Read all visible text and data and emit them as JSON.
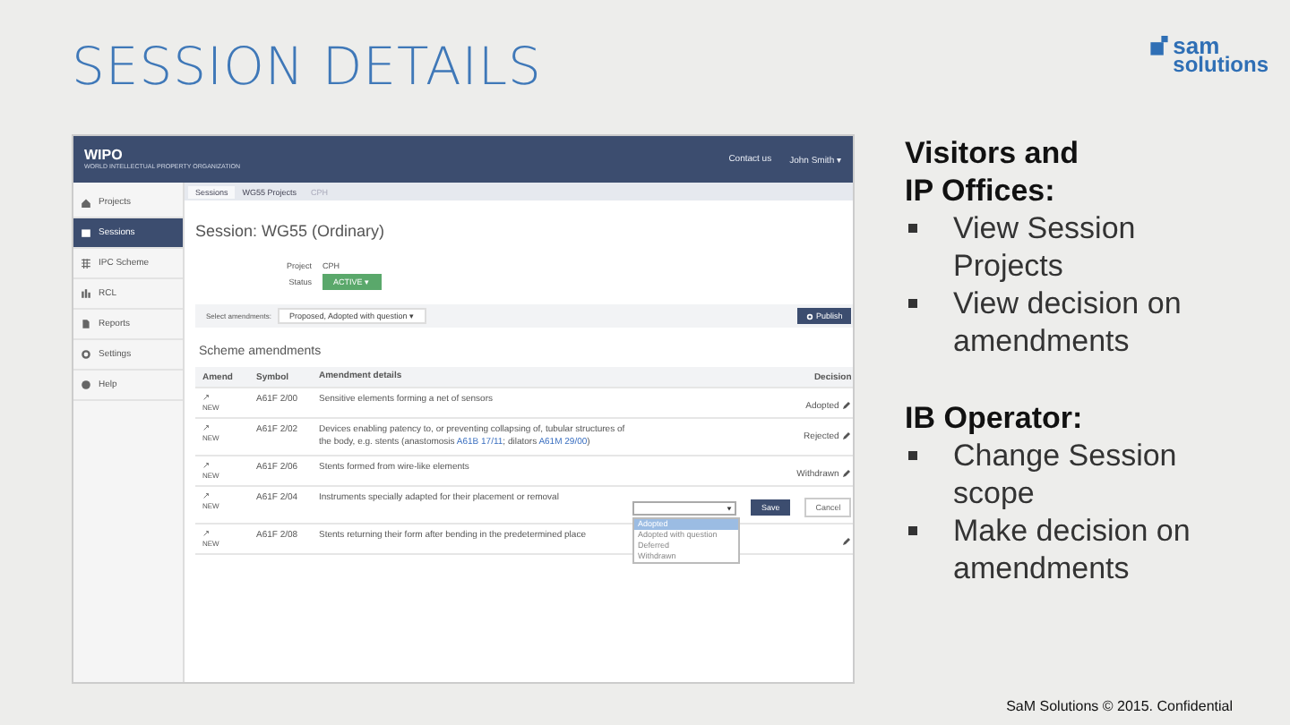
{
  "slide": {
    "title": "SESSION DETAILS",
    "logo": [
      "sam",
      "solutions"
    ],
    "footer": "SaM Solutions © 2015. Confidential"
  },
  "app": {
    "brand": {
      "name": "WIPO",
      "subtitle": "WORLD INTELLECTUAL PROPERTY ORGANIZATION"
    },
    "top_links": [
      "Contact us",
      "John Smith ▾"
    ],
    "sidebar": [
      {
        "label": "Projects",
        "selected": false
      },
      {
        "label": "Sessions",
        "selected": true
      },
      {
        "label": "IPC Scheme",
        "selected": false
      },
      {
        "label": "RCL",
        "selected": false
      },
      {
        "label": "Reports",
        "selected": false
      },
      {
        "label": "Settings",
        "selected": false
      },
      {
        "label": "Help",
        "selected": false
      }
    ],
    "tabs": [
      {
        "label": "Sessions",
        "selected": true,
        "disabled": false
      },
      {
        "label": "WG55 Projects",
        "selected": false,
        "disabled": false
      },
      {
        "label": "CPH",
        "selected": false,
        "disabled": true
      }
    ],
    "session_title": "Session: WG55 (Ordinary)",
    "fields": [
      {
        "label": "Project",
        "kind": "text",
        "value": "CPH"
      },
      {
        "label": "Status",
        "kind": "status",
        "value": "ACTIVE ▾"
      }
    ],
    "filter": {
      "label": "Select amendments:",
      "value": "Proposed, Adopted with question ▾",
      "button": "Publish"
    },
    "section_title": "Scheme amendments",
    "columns": [
      "Amend",
      "Symbol",
      "Amendment details",
      "Decision"
    ],
    "rows": [
      {
        "kind": "view",
        "amend": "NEW",
        "symbol": "A61F 2/00",
        "details": [
          {
            "text": "Sensitive elements forming a net of sensors",
            "link": false
          }
        ],
        "decision": "Adopted"
      },
      {
        "kind": "view",
        "amend": "NEW",
        "symbol": "A61F 2/02",
        "details": [
          {
            "text": "Devices enabling patency to, or preventing collapsing of, tubular structures of the body, e.g. stents (anastomosis ",
            "link": false
          },
          {
            "text": "A61B 17/11",
            "link": true
          },
          {
            "text": "; dilators ",
            "link": false
          },
          {
            "text": "A61M 29/00",
            "link": true
          },
          {
            "text": ")",
            "link": false
          }
        ],
        "decision": "Rejected"
      },
      {
        "kind": "view",
        "amend": "NEW",
        "symbol": "A61F 2/06",
        "details": [
          {
            "text": "Stents formed from wire-like elements",
            "link": false
          }
        ],
        "decision": "Withdrawn"
      },
      {
        "kind": "editing",
        "amend": "NEW",
        "symbol": "A61F 2/04",
        "details": [
          {
            "text": "Instruments specially adapted for their placement or removal",
            "link": false
          }
        ],
        "save": "Save",
        "cancel": "Cancel",
        "options": [
          {
            "label": "Adopted",
            "selected": true
          },
          {
            "label": "Adopted with question",
            "selected": false
          },
          {
            "label": "Deferred",
            "selected": false
          },
          {
            "label": "Withdrawn",
            "selected": false
          }
        ]
      },
      {
        "kind": "view",
        "amend": "NEW",
        "symbol": "A61F 2/08",
        "details": [
          {
            "text": "Stents returning their form after bending in the predetermined place",
            "link": false
          }
        ],
        "decision": ""
      }
    ]
  },
  "roles": [
    {
      "title": "Visitors and IP Offices:",
      "items": [
        "View Session Projects",
        "View decision on amendments"
      ]
    },
    {
      "title": "IB Operator:",
      "items": [
        "Change Session scope",
        "Make decision on amendments"
      ]
    }
  ]
}
